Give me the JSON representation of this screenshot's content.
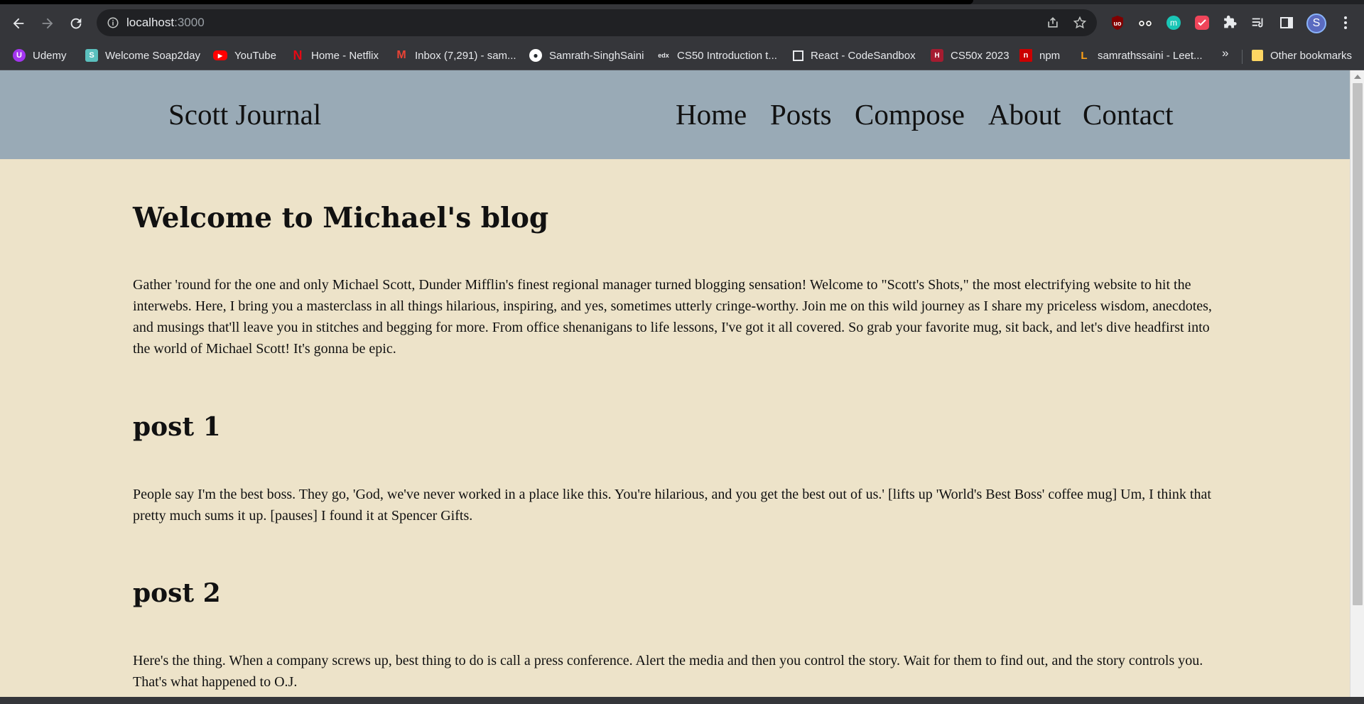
{
  "browser": {
    "url_host": "localhost",
    "url_port": ":3000",
    "avatar_letter": "S",
    "bookmarks": [
      {
        "label": "Udemy",
        "color": "#a435f0",
        "glyph": "U"
      },
      {
        "label": "Welcome Soap2day",
        "color": "#5bc0be",
        "glyph": "S"
      },
      {
        "label": "YouTube",
        "color": "#ff0000",
        "glyph": "▶"
      },
      {
        "label": "Home - Netflix",
        "color": "#e50914",
        "glyph": "N"
      },
      {
        "label": "Inbox (7,291) - sam...",
        "color": "#ea4335",
        "glyph": "M"
      },
      {
        "label": "Samrath-SinghSaini",
        "color": "#ffffff",
        "glyph": "●"
      },
      {
        "label": "CS50 Introduction t...",
        "color": "#35363a",
        "glyph": "edx"
      },
      {
        "label": "React - CodeSandbox",
        "color": "#35363a",
        "glyph": "□"
      },
      {
        "label": "CS50x 2023",
        "color": "#a51c30",
        "glyph": "H"
      },
      {
        "label": "npm",
        "color": "#cb0000",
        "glyph": "n"
      },
      {
        "label": "samrathssaini - Leet...",
        "color": "#ffa116",
        "glyph": "L"
      }
    ],
    "more_label": "»",
    "other_bookmarks": "Other bookmarks"
  },
  "site": {
    "brand": "Scott Journal",
    "nav": [
      "Home",
      "Posts",
      "Compose",
      "About",
      "Contact"
    ]
  },
  "content": {
    "welcome_title": "Welcome to Michael's blog",
    "intro": "Gather 'round for the one and only Michael Scott, Dunder Mifflin's finest regional manager turned blogging sensation! Welcome to \"Scott's Shots,\" the most electrifying website to hit the interwebs. Here, I bring you a masterclass in all things hilarious, inspiring, and yes, sometimes utterly cringe-worthy. Join me on this wild journey as I share my priceless wisdom, anecdotes, and musings that'll leave you in stitches and begging for more. From office shenanigans to life lessons, I've got it all covered. So grab your favorite mug, sit back, and let's dive headfirst into the world of Michael Scott! It's gonna be epic.",
    "posts": [
      {
        "title": "post 1",
        "body": "People say I'm the best boss. They go, 'God, we've never worked in a place like this. You're hilarious, and you get the best out of us.' [lifts up 'World's Best Boss' coffee mug] Um, I think that pretty much sums it up. [pauses] I found it at Spencer Gifts."
      },
      {
        "title": "post 2",
        "body": "Here's the thing. When a company screws up, best thing to do is call a press conference. Alert the media and then you control the story. Wait for them to find out, and the story controls you. That's what happened to O.J."
      }
    ]
  }
}
